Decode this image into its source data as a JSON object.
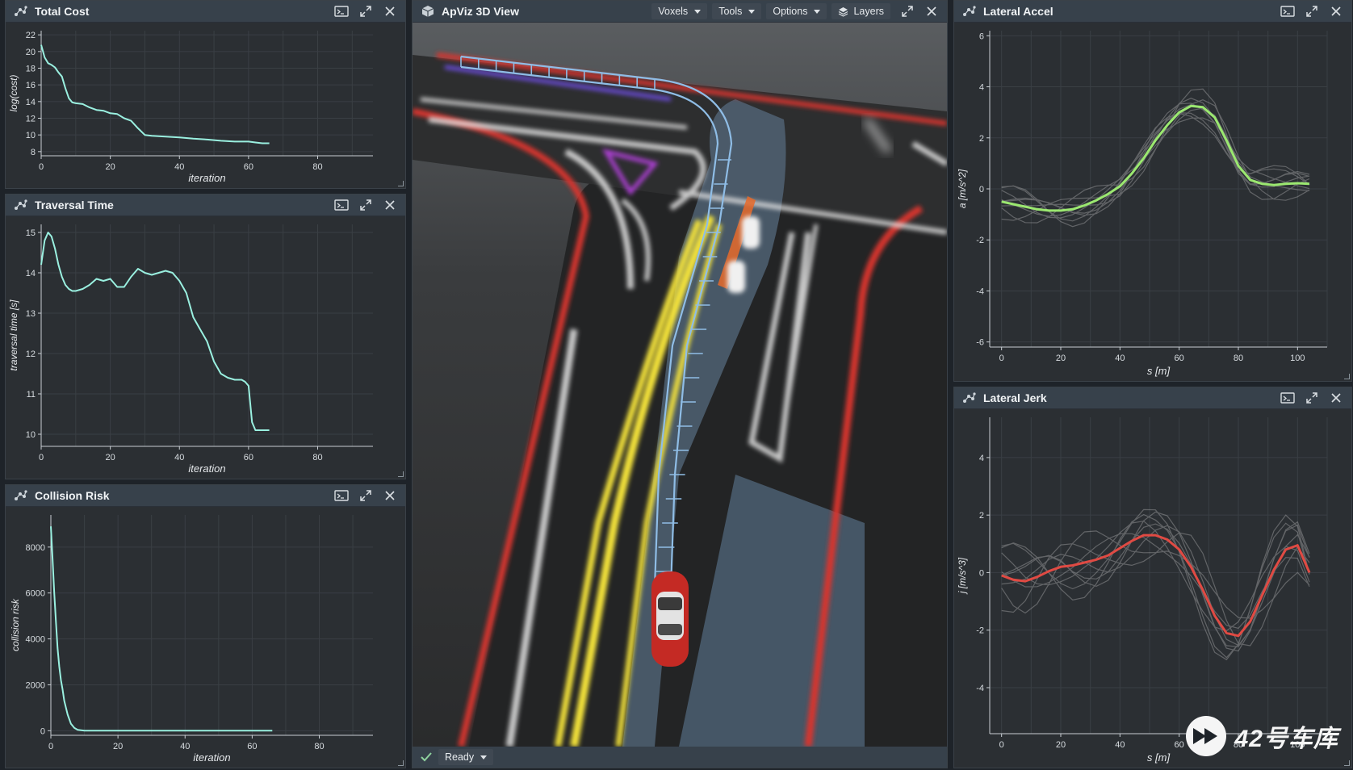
{
  "panels": {
    "total_cost": {
      "title": "Total Cost"
    },
    "traversal_time": {
      "title": "Traversal Time"
    },
    "collision_risk": {
      "title": "Collision Risk"
    },
    "view3d": {
      "title": "ApViz 3D View"
    },
    "lateral_accel": {
      "title": "Lateral Accel"
    },
    "lateral_jerk": {
      "title": "Lateral Jerk"
    }
  },
  "toolbar": {
    "voxels_label": "Voxels",
    "tools_label": "Tools",
    "options_label": "Options",
    "layers_label": "Layers"
  },
  "status": {
    "ready_label": "Ready"
  },
  "watermark": {
    "text": "42号车库"
  },
  "colors": {
    "cyan_series": "#9af0e0",
    "green_series": "#9be870",
    "red_series": "#e04a43",
    "gray_series": "#c8c8c8",
    "panel_bg": "#2b2f33",
    "titlebar_bg": "#37414b",
    "lane_yellow": "#f4e33a",
    "lane_red": "#d8352d",
    "grid_blue": "#8fbde6"
  },
  "icons": {
    "plot_panel": "scatter-plot-icon",
    "view3d": "cube-icon",
    "console": "console-icon",
    "maximize": "expand-icon",
    "close": "close-icon",
    "layers": "layers-icon",
    "status_ok": "check-icon"
  },
  "chart_data": [
    {
      "id": "total_cost",
      "type": "line",
      "title": "Total Cost",
      "xlabel": "iteration",
      "ylabel": "log(cost)",
      "xlim": [
        0,
        96
      ],
      "ylim": [
        7.5,
        22.5
      ],
      "xticks": [
        0,
        20,
        40,
        60,
        80
      ],
      "yticks": [
        8,
        10,
        12,
        14,
        16,
        18,
        20,
        22
      ],
      "grid": true,
      "series": [
        {
          "x": [
            0,
            1,
            2,
            3,
            4,
            5,
            6,
            7,
            8,
            9,
            10,
            12,
            14,
            16,
            18,
            20,
            22,
            24,
            26,
            28,
            30,
            32,
            36,
            40,
            44,
            48,
            52,
            56,
            60,
            62,
            64,
            66
          ],
          "values": [
            20.8,
            19.3,
            18.6,
            18.4,
            18.1,
            17.5,
            17.0,
            15.6,
            14.4,
            13.9,
            13.8,
            13.7,
            13.3,
            13.0,
            12.9,
            12.6,
            12.5,
            12.0,
            11.7,
            10.8,
            10.0,
            9.9,
            9.8,
            9.7,
            9.55,
            9.45,
            9.3,
            9.2,
            9.2,
            9.1,
            9.0,
            9.0
          ]
        }
      ]
    },
    {
      "id": "traversal_time",
      "type": "line",
      "title": "Traversal Time",
      "xlabel": "iteration",
      "ylabel": "traversal time [s]",
      "xlim": [
        0,
        96
      ],
      "ylim": [
        9.7,
        15.2
      ],
      "xticks": [
        0,
        20,
        40,
        60,
        80
      ],
      "yticks": [
        10,
        11,
        12,
        13,
        14,
        15
      ],
      "grid": true,
      "series": [
        {
          "x": [
            0,
            1,
            2,
            3,
            4,
            5,
            6,
            7,
            8,
            9,
            10,
            12,
            14,
            16,
            18,
            20,
            22,
            24,
            26,
            28,
            29,
            30,
            32,
            34,
            36,
            38,
            40,
            42,
            44,
            46,
            48,
            50,
            52,
            54,
            56,
            58,
            59,
            60,
            61,
            62,
            64,
            66
          ],
          "values": [
            14.2,
            14.8,
            15.0,
            14.9,
            14.6,
            14.2,
            13.9,
            13.7,
            13.6,
            13.55,
            13.55,
            13.6,
            13.7,
            13.85,
            13.8,
            13.85,
            13.65,
            13.65,
            13.9,
            14.1,
            14.05,
            14.0,
            13.95,
            14.0,
            14.05,
            14.0,
            13.8,
            13.5,
            12.9,
            12.6,
            12.3,
            11.8,
            11.5,
            11.4,
            11.35,
            11.35,
            11.3,
            11.2,
            10.3,
            10.1,
            10.1,
            10.1
          ]
        }
      ]
    },
    {
      "id": "collision_risk",
      "type": "line",
      "title": "Collision Risk",
      "xlabel": "iteration",
      "ylabel": "collision risk",
      "xlim": [
        0,
        96
      ],
      "ylim": [
        -200,
        9400
      ],
      "xticks": [
        0,
        20,
        40,
        60,
        80
      ],
      "yticks": [
        0,
        2000,
        4000,
        6000,
        8000
      ],
      "grid": true,
      "series": [
        {
          "x": [
            0,
            0.5,
            1,
            1.5,
            2,
            2.5,
            3,
            3.5,
            4,
            5,
            6,
            7,
            8,
            10,
            20,
            40,
            66
          ],
          "values": [
            8900,
            7500,
            6000,
            4800,
            3600,
            2800,
            2200,
            1800,
            1300,
            700,
            300,
            120,
            40,
            0,
            0,
            0,
            0
          ]
        }
      ]
    },
    {
      "id": "lateral_accel",
      "type": "line",
      "title": "Lateral Accel",
      "xlabel": "s [m]",
      "ylabel": "a [m/s^2]",
      "xlim": [
        -4,
        110
      ],
      "ylim": [
        -6.2,
        6.2
      ],
      "xticks": [
        0,
        20,
        40,
        60,
        80,
        100
      ],
      "yticks": [
        -6,
        -4,
        -2,
        0,
        2,
        4,
        6
      ],
      "grid": true,
      "series": [
        {
          "name": "",
          "x": [
            0,
            4,
            8,
            12,
            16,
            20,
            24,
            28,
            32,
            36,
            40,
            44,
            48,
            52,
            56,
            60,
            64,
            68,
            72,
            76,
            80,
            84,
            88,
            92,
            96,
            100,
            104
          ],
          "values": [
            -0.5,
            -0.6,
            -0.7,
            -0.8,
            -0.85,
            -0.85,
            -0.8,
            -0.65,
            -0.45,
            -0.2,
            0.1,
            0.6,
            1.2,
            1.9,
            2.5,
            3.0,
            3.25,
            3.2,
            2.8,
            1.9,
            0.9,
            0.35,
            0.2,
            0.15,
            0.2,
            0.22,
            0.2
          ]
        }
      ]
    },
    {
      "id": "lateral_jerk",
      "type": "line",
      "title": "Lateral Jerk",
      "xlabel": "s [m]",
      "ylabel": "j [m/s^3]",
      "xlim": [
        -4,
        110
      ],
      "ylim": [
        -5.6,
        5.4
      ],
      "xticks": [
        0,
        20,
        40,
        60,
        80,
        100
      ],
      "yticks": [
        -4,
        -2,
        0,
        2,
        4
      ],
      "grid": true,
      "series": [
        {
          "name": "",
          "x": [
            0,
            4,
            8,
            12,
            16,
            20,
            24,
            28,
            32,
            36,
            40,
            44,
            48,
            52,
            56,
            60,
            64,
            68,
            72,
            76,
            80,
            84,
            88,
            92,
            96,
            100,
            104
          ],
          "values": [
            -0.1,
            -0.25,
            -0.3,
            -0.15,
            0.05,
            0.2,
            0.25,
            0.35,
            0.45,
            0.6,
            0.85,
            1.1,
            1.3,
            1.3,
            1.15,
            0.8,
            0.2,
            -0.6,
            -1.5,
            -2.1,
            -2.2,
            -1.7,
            -0.8,
            0.1,
            0.8,
            0.95,
            0.0
          ]
        }
      ]
    }
  ]
}
